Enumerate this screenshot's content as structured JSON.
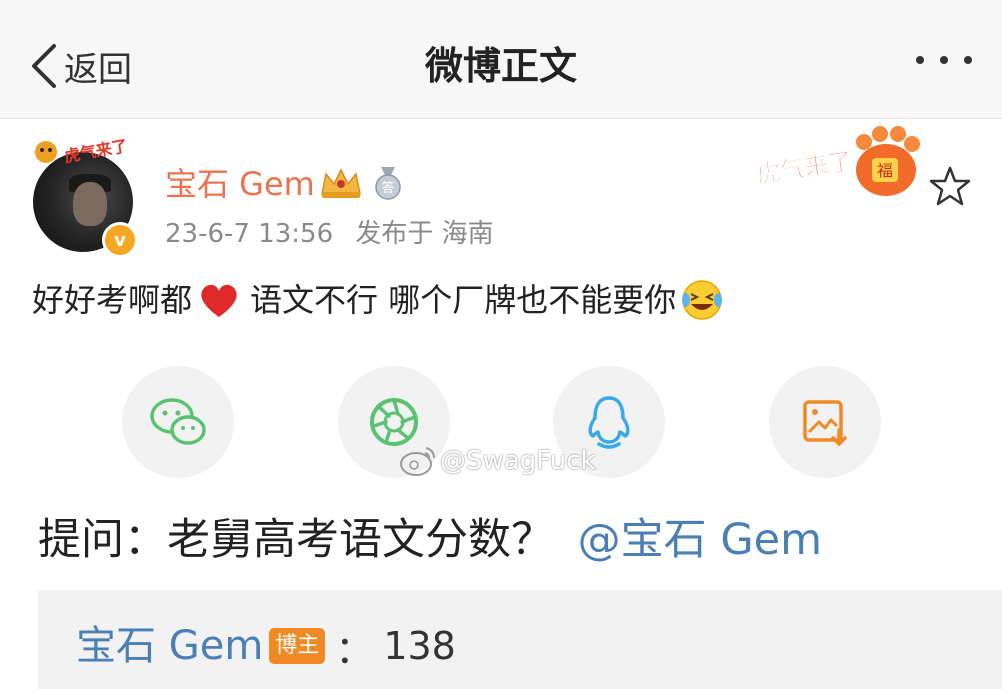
{
  "nav": {
    "back_label": "返回",
    "title": "微博正文"
  },
  "post": {
    "username": "宝石 Gem",
    "medal_text": "答",
    "sticker_text": "虎气来了",
    "fortune_char": "福",
    "avatar_sticker_text": "虎气来了",
    "verified_mark": "v",
    "timestamp": "23-6-7 13:56",
    "location": "发布于 海南",
    "text_part1": "好好考啊都",
    "text_part2": "语文不行 哪个厂牌也不能要你"
  },
  "share": [
    "wechat",
    "moments",
    "qq",
    "save-image"
  ],
  "watermark": "@SwagFuck",
  "question": {
    "text": "提问：老舅高考语文分数？",
    "mention": "@宝石 Gem"
  },
  "answer": {
    "name": "宝石 Gem",
    "tag": "博主",
    "separator": "：",
    "value": "138"
  },
  "colors": {
    "username": "#eb7350",
    "link": "#4a7fb5",
    "meta": "#8a8a8a",
    "share_green": "#5ac371",
    "share_blue": "#39a9e9",
    "share_orange": "#f08a24"
  }
}
